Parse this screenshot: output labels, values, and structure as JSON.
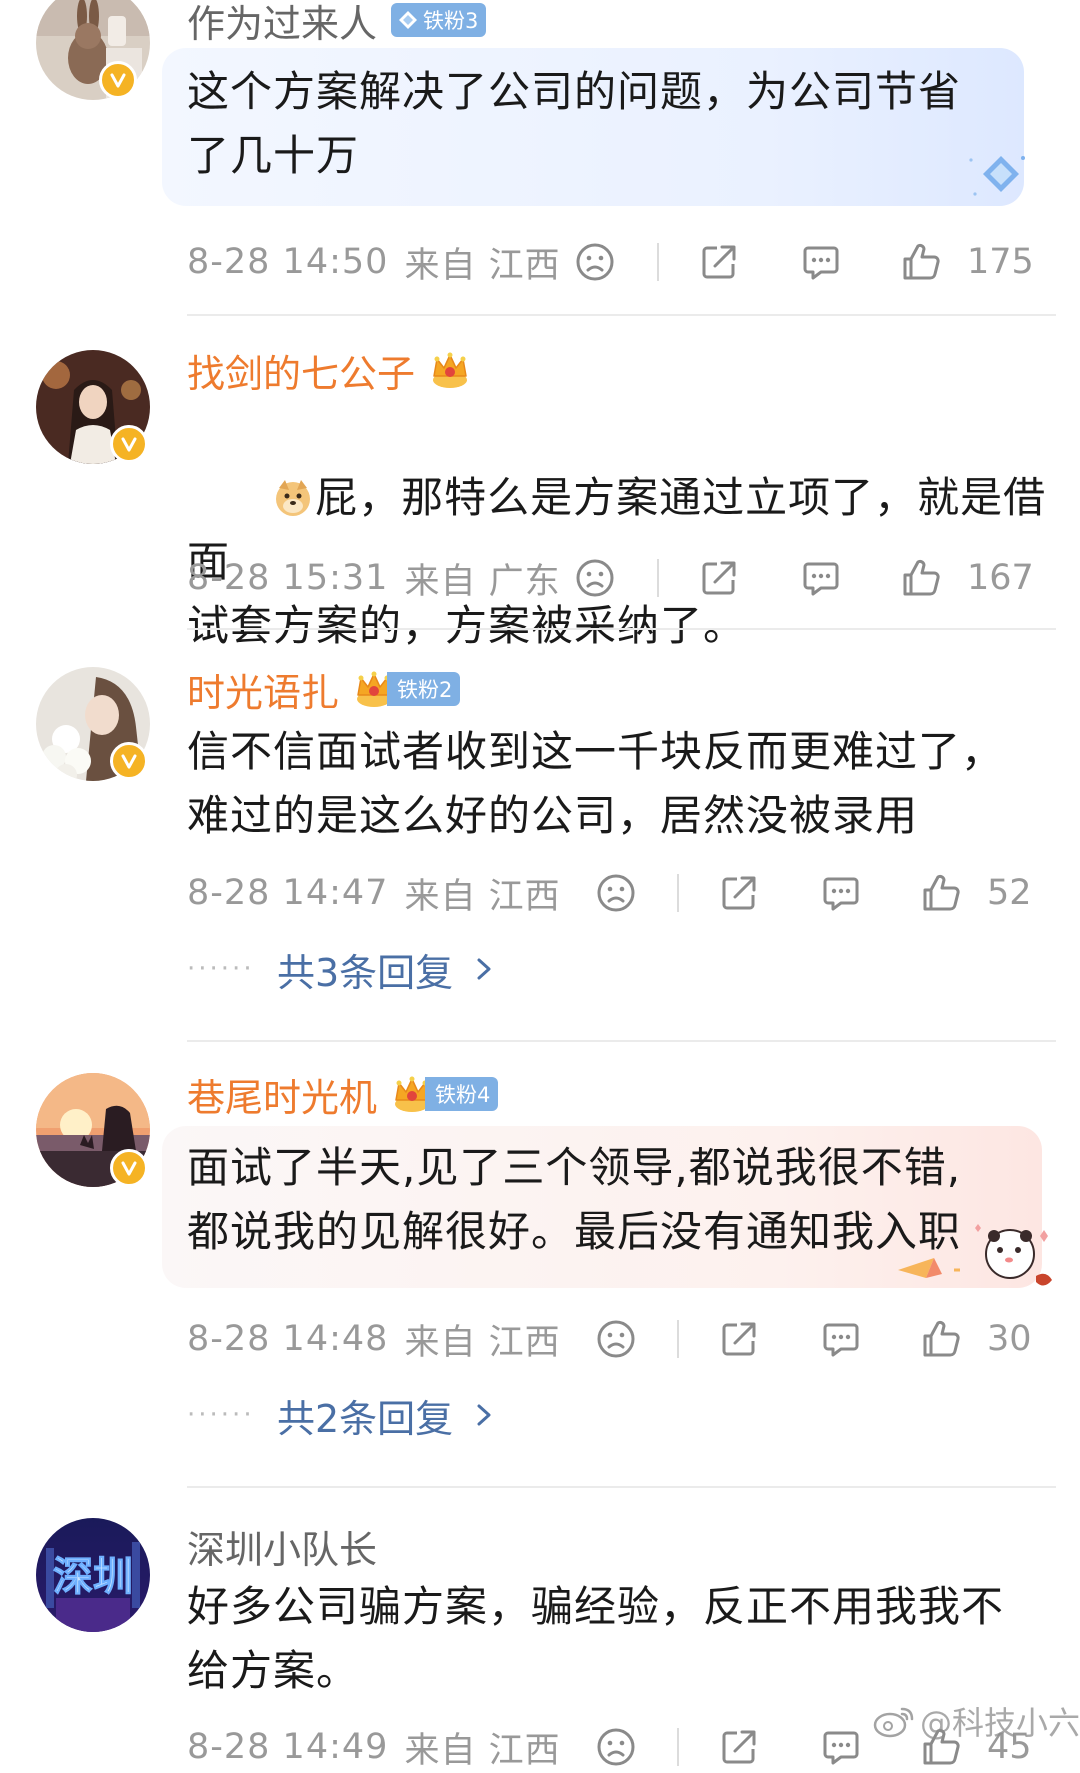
{
  "comments": [
    {
      "username": "作为过来人",
      "fan_badge": "铁粉3",
      "text": "这个方案解决了公司的问题，为公司节省\n了几十万",
      "time": "8-28 14:50",
      "source": "来自 江西",
      "likes": "175"
    },
    {
      "username": "找剑的七公子",
      "text": "屁，那特么是方案通过立项了，就是借面\n试套方案的，方案被采纳了。",
      "time": "8-28 15:31",
      "source": "来自 广东",
      "likes": "167"
    },
    {
      "username": "时光语扎",
      "fan_badge": "铁粉2",
      "text": "信不信面试者收到这一千块反而更难过了，\n难过的是这么好的公司，居然没被录用",
      "time": "8-28 14:47",
      "source": "来自 江西",
      "likes": "52",
      "replies": "共3条回复"
    },
    {
      "username": "巷尾时光机",
      "fan_badge": "铁粉4",
      "text": "面试了半天,见了三个领导,都说我很不错,\n都说我的见解很好。最后没有通知我入职",
      "time": "8-28 14:48",
      "source": "来自 江西",
      "likes": "30",
      "replies": "共2条回复"
    },
    {
      "username": "深圳小队长",
      "avatar_text": "深圳",
      "text": "好多公司骗方案，骗经验，反正不用我我不\n给方案。",
      "time": "8-28 14:49",
      "source": "来自 江西",
      "likes": "45"
    }
  ],
  "watermark": "@科技小六",
  "colors": {
    "vip_name": "#ee7b2e",
    "normal_name": "#666666",
    "meta": "#999999",
    "reply_link": "#4a6fa5",
    "verified_badge": "#f5b324",
    "fan_badge": "#7fb0e4"
  },
  "icons": [
    "sad-face-icon",
    "share-icon",
    "comment-icon",
    "thumbs-up-icon",
    "verified-v-icon",
    "crown-icon",
    "diamond-icon",
    "chevron-right-icon",
    "weibo-logo-icon"
  ]
}
